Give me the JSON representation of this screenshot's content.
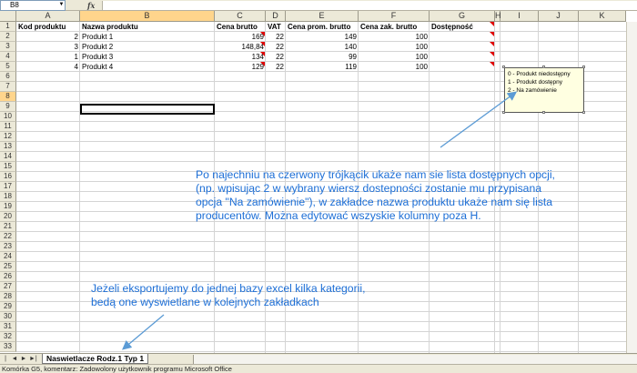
{
  "formula_bar": {
    "name_box": "B8",
    "fx_label": "fx",
    "formula_value": ""
  },
  "columns": [
    "A",
    "B",
    "C",
    "D",
    "E",
    "F",
    "G",
    "H",
    "I",
    "J",
    "K"
  ],
  "selected_column": "B",
  "rows": [
    "1",
    "2",
    "3",
    "4",
    "5",
    "6",
    "7",
    "8",
    "9",
    "10",
    "11",
    "12",
    "13",
    "14",
    "15",
    "16",
    "17",
    "18",
    "19",
    "20",
    "21",
    "22",
    "23",
    "24",
    "25",
    "26",
    "27",
    "28",
    "29",
    "30",
    "31",
    "32",
    "33"
  ],
  "selected_row": "8",
  "header_row": [
    "Kod produktu",
    "Nazwa produktu",
    "Cena brutto",
    "VAT",
    "Cena prom. brutto",
    "Cena zak. brutto",
    "Dostępność"
  ],
  "data_rows": [
    {
      "kod": "2",
      "nazwa": "Produkt 1",
      "cena": "169",
      "vat": "22",
      "prom": "149",
      "zak": "100"
    },
    {
      "kod": "3",
      "nazwa": "Produkt 2",
      "cena": "148,84",
      "vat": "22",
      "prom": "140",
      "zak": "100"
    },
    {
      "kod": "1",
      "nazwa": "Produkt 3",
      "cena": "134",
      "vat": "22",
      "prom": "99",
      "zak": "100"
    },
    {
      "kod": "4",
      "nazwa": "Produkt 4",
      "cena": "129",
      "vat": "22",
      "prom": "119",
      "zak": "100"
    }
  ],
  "comment": {
    "lines": [
      "0 - Produkt niedostępny",
      "1 - Produkt dostępny",
      "2 - Na zamówienie"
    ]
  },
  "annotation_main": {
    "lines": [
      "Po najechniu na czerwony trójkącik ukaże nam sie lista dostępnych opcji,",
      "(np. wpisując 2 w wybrany wiersz dostepności zostanie mu przypisana",
      "opcja \"Na zamówienie\"), w zakładce nazwa produktu ukaże nam się lista",
      "producentów. Można edytować wszyskie kolumny poza H."
    ]
  },
  "annotation_tabs": {
    "lines": [
      "Jeżeli eksportujemy do jednej bazy excel kilka kategorii,",
      "bedą one wyswietlane w kolejnych zakładkach"
    ]
  },
  "sheet_tabs": [
    "Naswietlacze Rodz.1 Typ 1"
  ],
  "active_sheet": "Naswietlacze Rodz.1 Typ 1",
  "nav_buttons": [
    "|◄",
    "◄",
    "►",
    "►|"
  ],
  "status_bar": "Komórka G5, komentarz: Zadowolony użytkownik programu Microsoft Office",
  "colors": {
    "annotation": "#1c6ed6",
    "arrow": "#5b9bd5",
    "comment_bg": "#ffffe1",
    "selection_header": "#ffd58c",
    "red_triangle": "#e00000"
  }
}
